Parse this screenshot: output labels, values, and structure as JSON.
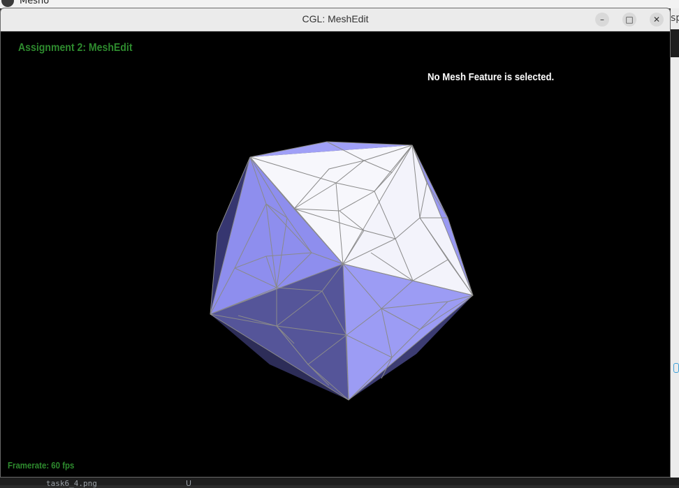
{
  "desktop": {
    "app_name": "Mesho",
    "peek_text": "sp",
    "bottom_file": "task6_4.png",
    "bottom_mark": "U"
  },
  "window": {
    "title": "CGL: MeshEdit",
    "minimize_glyph": "–",
    "maximize_glyph": "□",
    "close_glyph": "✕"
  },
  "viewport": {
    "app_title": "Assignment 2: MeshEdit",
    "status": "No Mesh Feature is selected.",
    "framerate": "Framerate: 60 fps"
  },
  "colors": {
    "face_white": "#f5f5fb",
    "face_light": "#9a9af5",
    "face_mid": "#7c7ce0",
    "face_dark": "#525293",
    "face_shadow": "#2c2c52",
    "edge": "#8a8a8a",
    "label_green": "#2e8b2e"
  },
  "mesh": {
    "shape": "subdivided icosahedron",
    "selection": "none"
  }
}
